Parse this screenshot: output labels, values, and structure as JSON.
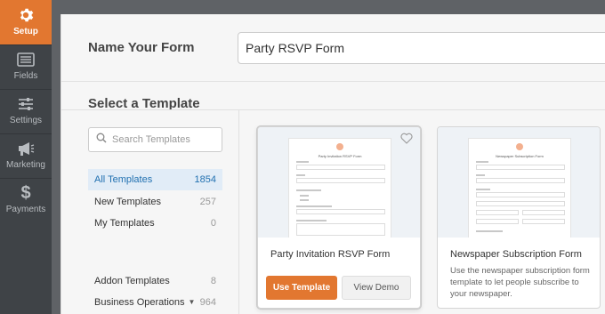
{
  "sidebar": {
    "items": [
      {
        "label": "Setup",
        "icon": "gear-icon",
        "active": true
      },
      {
        "label": "Fields",
        "icon": "fields-list-icon",
        "active": false
      },
      {
        "label": "Settings",
        "icon": "sliders-icon",
        "active": false
      },
      {
        "label": "Marketing",
        "icon": "megaphone-icon",
        "active": false
      },
      {
        "label": "Payments",
        "icon": "dollar-icon",
        "active": false
      }
    ]
  },
  "name_form": {
    "label": "Name Your Form",
    "value": "Party RSVP Form"
  },
  "templates": {
    "title": "Select a Template",
    "search_placeholder": "Search Templates",
    "categories": [
      {
        "label": "All Templates",
        "count": "1854",
        "active": true
      },
      {
        "label": "New Templates",
        "count": "257"
      },
      {
        "label": "My Templates",
        "count": "0"
      },
      {
        "label": "Addon Templates",
        "count": "8"
      },
      {
        "label": "Business Operations",
        "count": "964"
      }
    ],
    "cards": [
      {
        "title": "Party Invitation RSVP Form",
        "preview_title": "Party Invitation RSVP Form",
        "use_label": "Use Template",
        "demo_label": "View Demo"
      },
      {
        "title": "Newspaper Subscription Form",
        "preview_title": "Newspaper Subscription Form",
        "description": "Use the newspaper subscription form template to let people subscribe to your newspaper."
      }
    ]
  },
  "colors": {
    "accent": "#e27730",
    "sidebar_bg": "#3f4347",
    "active_category_bg": "#e1ecf7",
    "active_category_text": "#2271b1"
  }
}
